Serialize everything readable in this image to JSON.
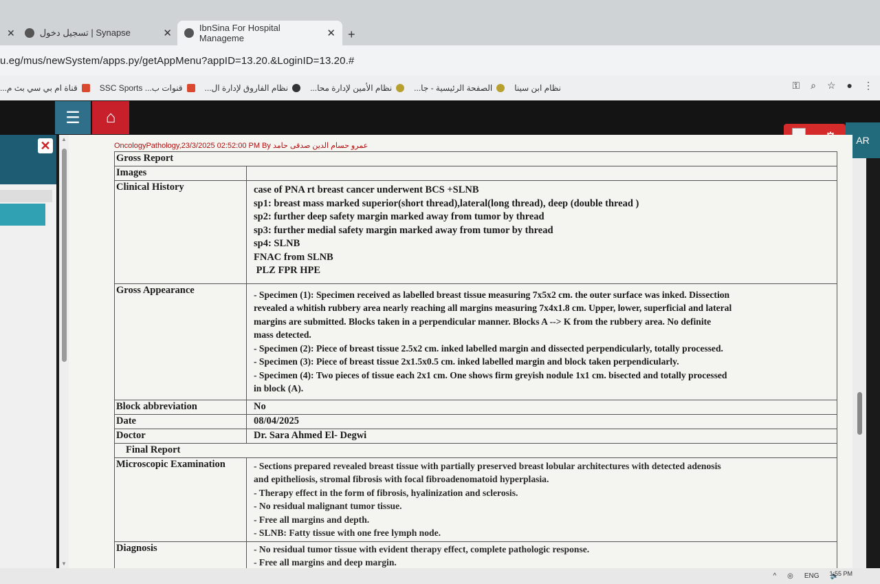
{
  "browser": {
    "tabs": [
      {
        "title": "تسجيل دخول | Synapse",
        "active": false
      },
      {
        "title": "IbnSina For Hospital Manageme",
        "active": true
      }
    ],
    "url": "u.eg/mus/newSystem/apps.py/getAppMenu?appID=13.20.&LoginID=13.20.#",
    "bookmarks": [
      {
        "label": "نظام ابن سينا",
        "icon": "globe-icon"
      },
      {
        "label": "الصفحة الرئيسية - جا...",
        "icon": "site-icon"
      },
      {
        "label": "نظام الأمين لإدارة محا...",
        "icon": "site-icon"
      },
      {
        "label": "نظام الفاروق لإدارة ال...",
        "icon": "globe-icon"
      },
      {
        "label": "قنوات ب... SSC Sports",
        "icon": "e-icon"
      },
      {
        "label": "قناة ام بي سي بث م...",
        "icon": "e-icon"
      }
    ]
  },
  "app": {
    "lang_button": "AR",
    "stamp": "OncologyPathology,23/3/2025 02:52:00 PM By عمرو حسام الدين صدقى حامد"
  },
  "report": {
    "gross_report_label": "Gross Report",
    "images_label": "Images",
    "clinical_history_label": "Clinical History",
    "clinical_history": [
      "case of PNA rt breast cancer underwent BCS +SLNB",
      "sp1: breast mass marked superior(short thread),lateral(long thread), deep (double thread )",
      "sp2: further deep safety margin  marked away from tumor by thread",
      "sp3: further medial  safety margin marked away from tumor by thread",
      "sp4: SLNB",
      "FNAC from SLNB",
      " PLZ FPR HPE"
    ],
    "gross_appearance_label": "Gross Appearance",
    "gross_appearance": [
      "- Specimen (1): Specimen received as labelled breast tissue measuring 7x5x2 cm. the outer surface was inked. Dissection",
      "revealed a whitish rubbery area nearly reaching all margins measuring 7x4x1.8 cm. Upper, lower, superficial and lateral",
      "margins are submitted. Blocks taken  in a perpendicular manner. Blocks A --> K from the rubbery area. No definite",
      "mass detected.",
      "- Specimen (2): Piece of breast tissue 2.5x2 cm. inked labelled margin and dissected perpendicularly, totally processed.",
      "- Specimen (3): Piece of breast tissue 2x1.5x0.5 cm. inked labelled margin and block taken perpendicularly.",
      "- Specimen (4): Two pieces of tissue each 2x1 cm. One shows firm greyish nodule 1x1 cm. bisected and totally processed",
      "in block (A)."
    ],
    "block_abbreviation_label": "Block abbreviation",
    "block_abbreviation": "No",
    "date_label": "Date",
    "date": "08/04/2025",
    "doctor_label": "Doctor",
    "doctor": "Dr. Sara Ahmed El- Degwi",
    "final_report_label": "Final Report",
    "microscopic_label": "Microscopic Examination",
    "microscopic": [
      "- Sections prepared revealed breast tissue with partially preserved breast lobular architectures with detected adenosis",
      "and epitheliosis, stromal fibrosis with focal fibroadenomatoid hyperplasia.",
      "- Therapy effect in the form of fibrosis, hyalinization and sclerosis.",
      "- No residual malignant tumor tissue.",
      "- Free all margins and depth.",
      "- SLNB: Fatty tissue with one free lymph node."
    ],
    "diagnosis_label": "Diagnosis",
    "diagnosis": [
      "- No residual tumor tissue with evident therapy effect, complete pathologic response.",
      "- Free all margins and deep margin."
    ]
  },
  "taskbar": {
    "lang": "ENG",
    "time": "1:55 PM"
  }
}
